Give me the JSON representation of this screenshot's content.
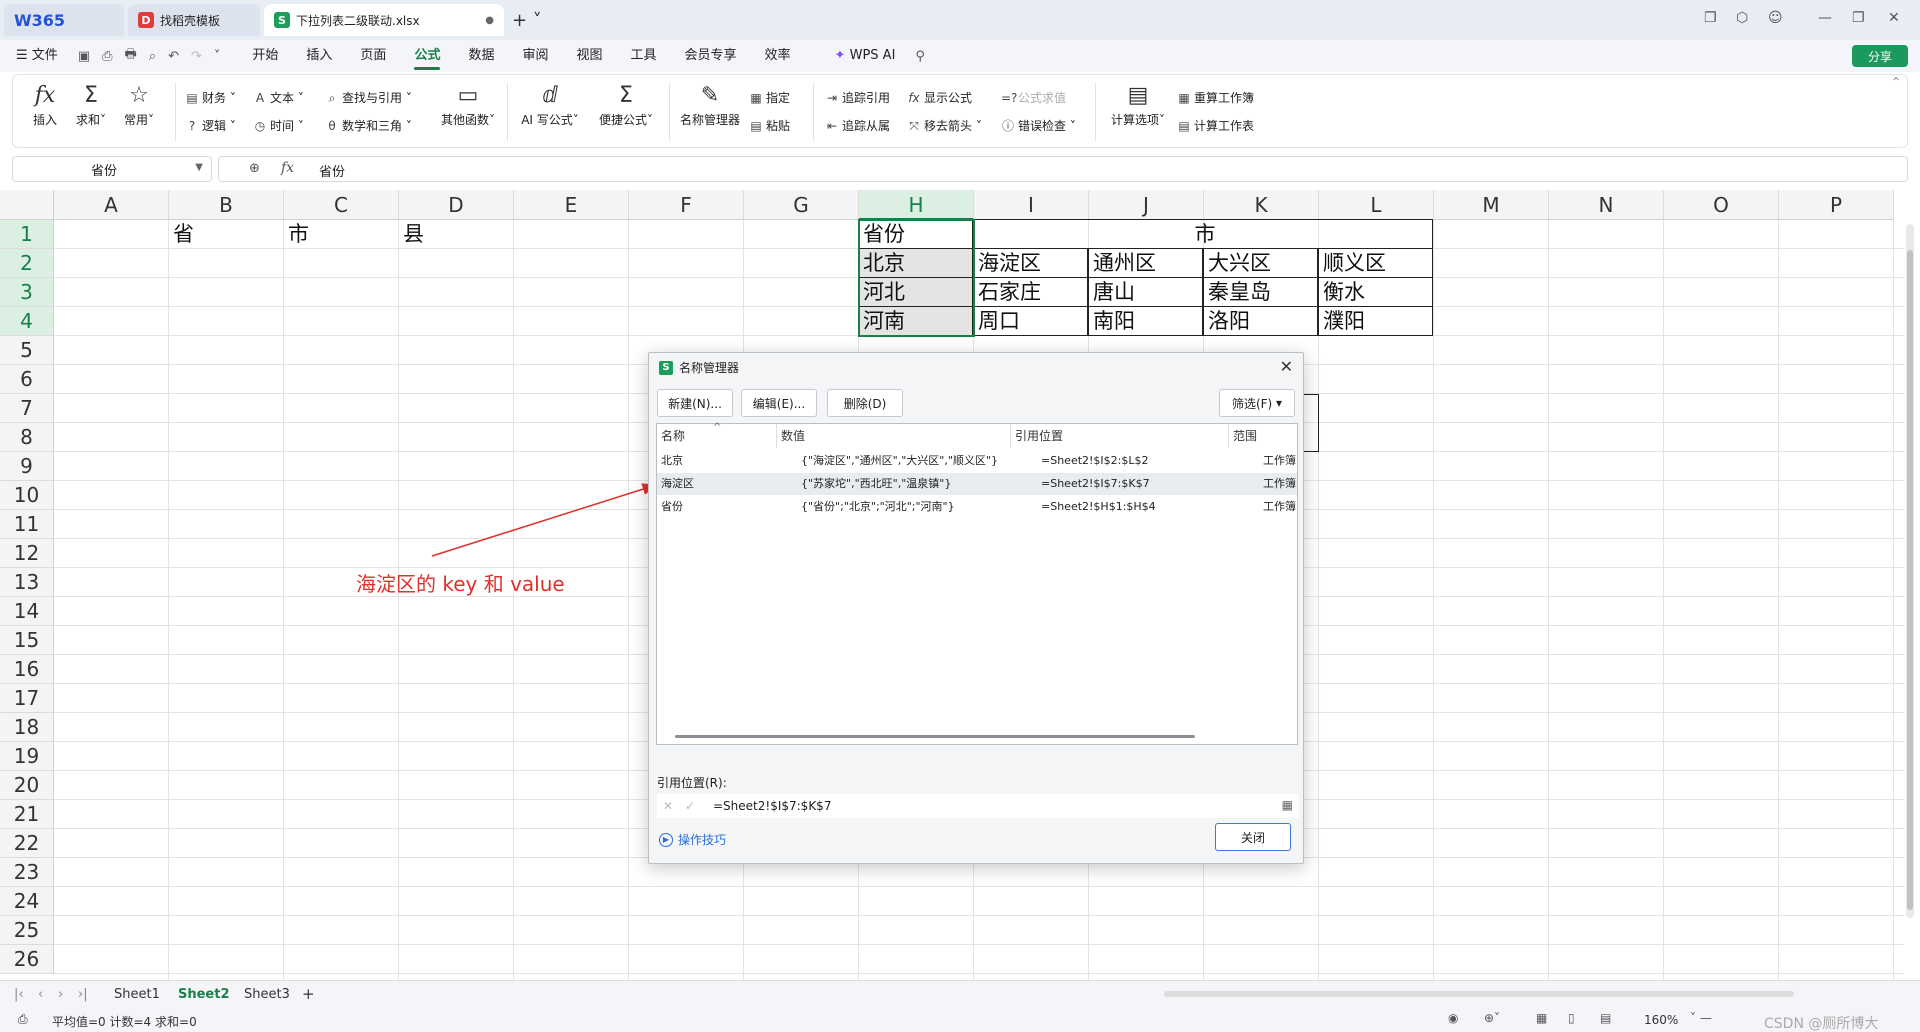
{
  "tabs": {
    "logo": "W365",
    "tab2": "找稻壳模板",
    "tab3": "下拉列表二级联动.xlsx"
  },
  "menu": {
    "file": "文件",
    "items": [
      "开始",
      "插入",
      "页面",
      "公式",
      "数据",
      "审阅",
      "视图",
      "工具",
      "会员专享",
      "效率"
    ],
    "active": "公式",
    "wps_ai": "WPS AI",
    "share": "分享"
  },
  "ribbon": {
    "insert": "插入",
    "sum": "求和",
    "common": "常用",
    "finance": "财务",
    "logic": "逻辑",
    "text": "文本",
    "time": "时间",
    "lookup": "查找与引用",
    "math": "数学和三角",
    "other": "其他函数",
    "ai_formula": "AI 写公式",
    "quick_formula": "便捷公式",
    "name_mgr": "名称管理器",
    "define": "指定",
    "paste": "粘贴",
    "trace_prec": "追踪引用",
    "trace_dep": "追踪从属",
    "show_formula": "显示公式",
    "remove_arrow": "移去箭头",
    "eval_formula": "公式求值",
    "error_check": "错误检查",
    "calc_options": "计算选项",
    "recalc_book": "重算工作簿",
    "calc_sheet": "计算工作表"
  },
  "formula_bar": {
    "name_box": "省份",
    "fx": "fx",
    "value": "省份"
  },
  "grid": {
    "columns": [
      "A",
      "B",
      "C",
      "D",
      "E",
      "F",
      "G",
      "H",
      "I",
      "J",
      "K",
      "L",
      "M",
      "N",
      "O",
      "P"
    ],
    "selected_column": "H",
    "rows": [
      "1",
      "2",
      "3",
      "4",
      "5",
      "6",
      "7",
      "8",
      "9",
      "10",
      "11",
      "12",
      "13",
      "14",
      "15",
      "16",
      "17",
      "18",
      "19",
      "20",
      "21",
      "22",
      "23",
      "24",
      "25",
      "26"
    ],
    "b1": "省",
    "c1": "市",
    "d1": "县",
    "h1": "省份",
    "city_header": "市",
    "provinces": [
      "北京",
      "河北",
      "河南"
    ],
    "cities": [
      [
        "海淀区",
        "通州区",
        "大兴区",
        "顺义区"
      ],
      [
        "石家庄",
        "唐山",
        "秦皇岛",
        "衡水"
      ],
      [
        "周口",
        "南阳",
        "洛阳",
        "濮阳"
      ]
    ]
  },
  "annotation": "海淀区的 key 和 value",
  "dialog": {
    "title": "名称管理器",
    "new_btn": "新建(N)...",
    "edit_btn": "编辑(E)...",
    "delete_btn": "删除(D)",
    "filter_btn": "筛选(F)",
    "col_name": "名称",
    "col_value": "数值",
    "col_ref": "引用位置",
    "col_scope": "范围",
    "rows": [
      {
        "name": "北京",
        "value": "{\"海淀区\",\"通州区\",\"大兴区\",\"顺义区\"}",
        "ref": "=Sheet2!$I$2:$L$2",
        "scope": "工作簿"
      },
      {
        "name": "海淀区",
        "value": "{\"苏家坨\",\"西北旺\",\"温泉镇\"}",
        "ref": "=Sheet2!$I$7:$K$7",
        "scope": "工作簿"
      },
      {
        "name": "省份",
        "value": "{\"省份\";\"北京\";\"河北\";\"河南\"}",
        "ref": "=Sheet2!$H$1:$H$4",
        "scope": "工作簿"
      }
    ],
    "selected_row": 1,
    "ref_label": "引用位置(R):",
    "ref_value": "=Sheet2!$I$7:$K$7",
    "tips": "操作技巧",
    "close_btn": "关闭"
  },
  "sheets": {
    "names": [
      "Sheet1",
      "Sheet2",
      "Sheet3"
    ],
    "active": "Sheet2"
  },
  "status": {
    "stats": "平均值=0  计数=4  求和=0",
    "zoom": "160%",
    "watermark": "CSDN @厕所博大"
  }
}
